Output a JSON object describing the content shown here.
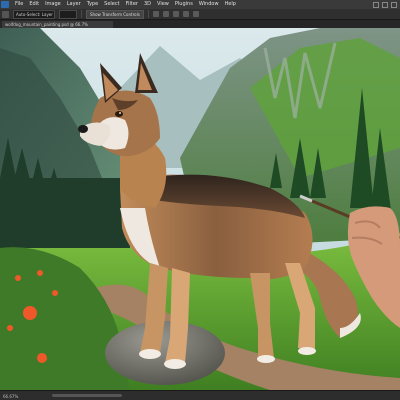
{
  "menubar": {
    "items": [
      "File",
      "Edit",
      "Image",
      "Layer",
      "Type",
      "Select",
      "Filter",
      "3D",
      "View",
      "Plugins",
      "Window",
      "Help"
    ]
  },
  "optbar": {
    "field1": "Auto-Select: Layer",
    "field2": "Show Transform Controls"
  },
  "document": {
    "tab_title": "wolfdog_mountain_painting.psd @ 66.7%"
  },
  "status": {
    "zoom": "66.67%"
  },
  "colors": {
    "sky": "#cfe3e8",
    "meadow": "#6fb43a",
    "path": "#a07a5a",
    "wolf_dark": "#3b2a20",
    "wolf_tan": "#b98356",
    "wolf_light": "#efe8e0",
    "flower": "#f0582a"
  }
}
